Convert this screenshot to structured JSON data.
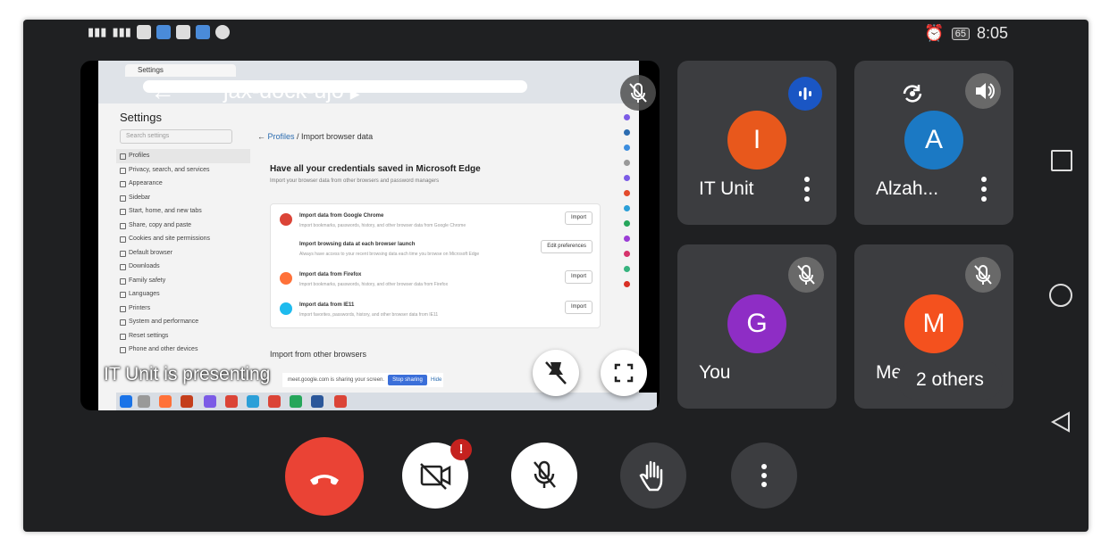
{
  "status_bar": {
    "battery": "65",
    "time": "8:05"
  },
  "presentation": {
    "meeting_code": "jax-dock-ujo",
    "presenter_label": "IT Unit is presenting",
    "shared_screen": {
      "tab_title": "Settings",
      "sidebar_title": "Settings",
      "sidebar_search": "Search settings",
      "sidebar_items": [
        "Profiles",
        "Privacy, search, and services",
        "Appearance",
        "Sidebar",
        "Start, home, and new tabs",
        "Share, copy and paste",
        "Cookies and site permissions",
        "Default browser",
        "Downloads",
        "Family safety",
        "Languages",
        "Printers",
        "System and performance",
        "Reset settings",
        "Phone and other devices"
      ],
      "breadcrumb_link": "Profiles",
      "breadcrumb_current": "/ Import browser data",
      "heading": "Have all your credentials saved in Microsoft Edge",
      "subheading": "Import your browser data from other browsers and password managers",
      "rows": [
        {
          "title": "Import data from Google Chrome",
          "sub": "Import bookmarks, passwords, history, and other browser data from Google Chrome",
          "button": "Import",
          "color": "#db4437"
        },
        {
          "title": "Import browsing data at each browser launch",
          "sub": "Always have access to your recent browsing data each time you browse on Microsoft Edge",
          "button": "Edit preferences",
          "color": ""
        },
        {
          "title": "Import data from Firefox",
          "sub": "Import bookmarks, passwords, history, and other browser data from Firefox",
          "button": "Import",
          "color": "#ff7139"
        },
        {
          "title": "Import data from IE11",
          "sub": "Import favorites, passwords, history, and other browser data from IE11",
          "button": "Import",
          "color": "#1ebbee"
        }
      ],
      "section_heading": "Import from other browsers",
      "share_notice": "meet.google.com is sharing your screen.",
      "share_stop": "Stop sharing",
      "share_hide": "Hide"
    }
  },
  "participants": [
    {
      "name": "IT Unit",
      "initial": "I",
      "color": "#e8581c"
    },
    {
      "name": "Alzah...",
      "initial": "A",
      "color": "#1b79c4"
    },
    {
      "name": "You",
      "initial": "G",
      "color": "#8e2dc5"
    },
    {
      "name": "Me",
      "initial": "M",
      "color": "#f4511e"
    }
  ],
  "others_label": "2 others",
  "colors": {
    "end_call": "#ea4335",
    "alert": "#c5221f",
    "speaking": "#1a56c4"
  }
}
